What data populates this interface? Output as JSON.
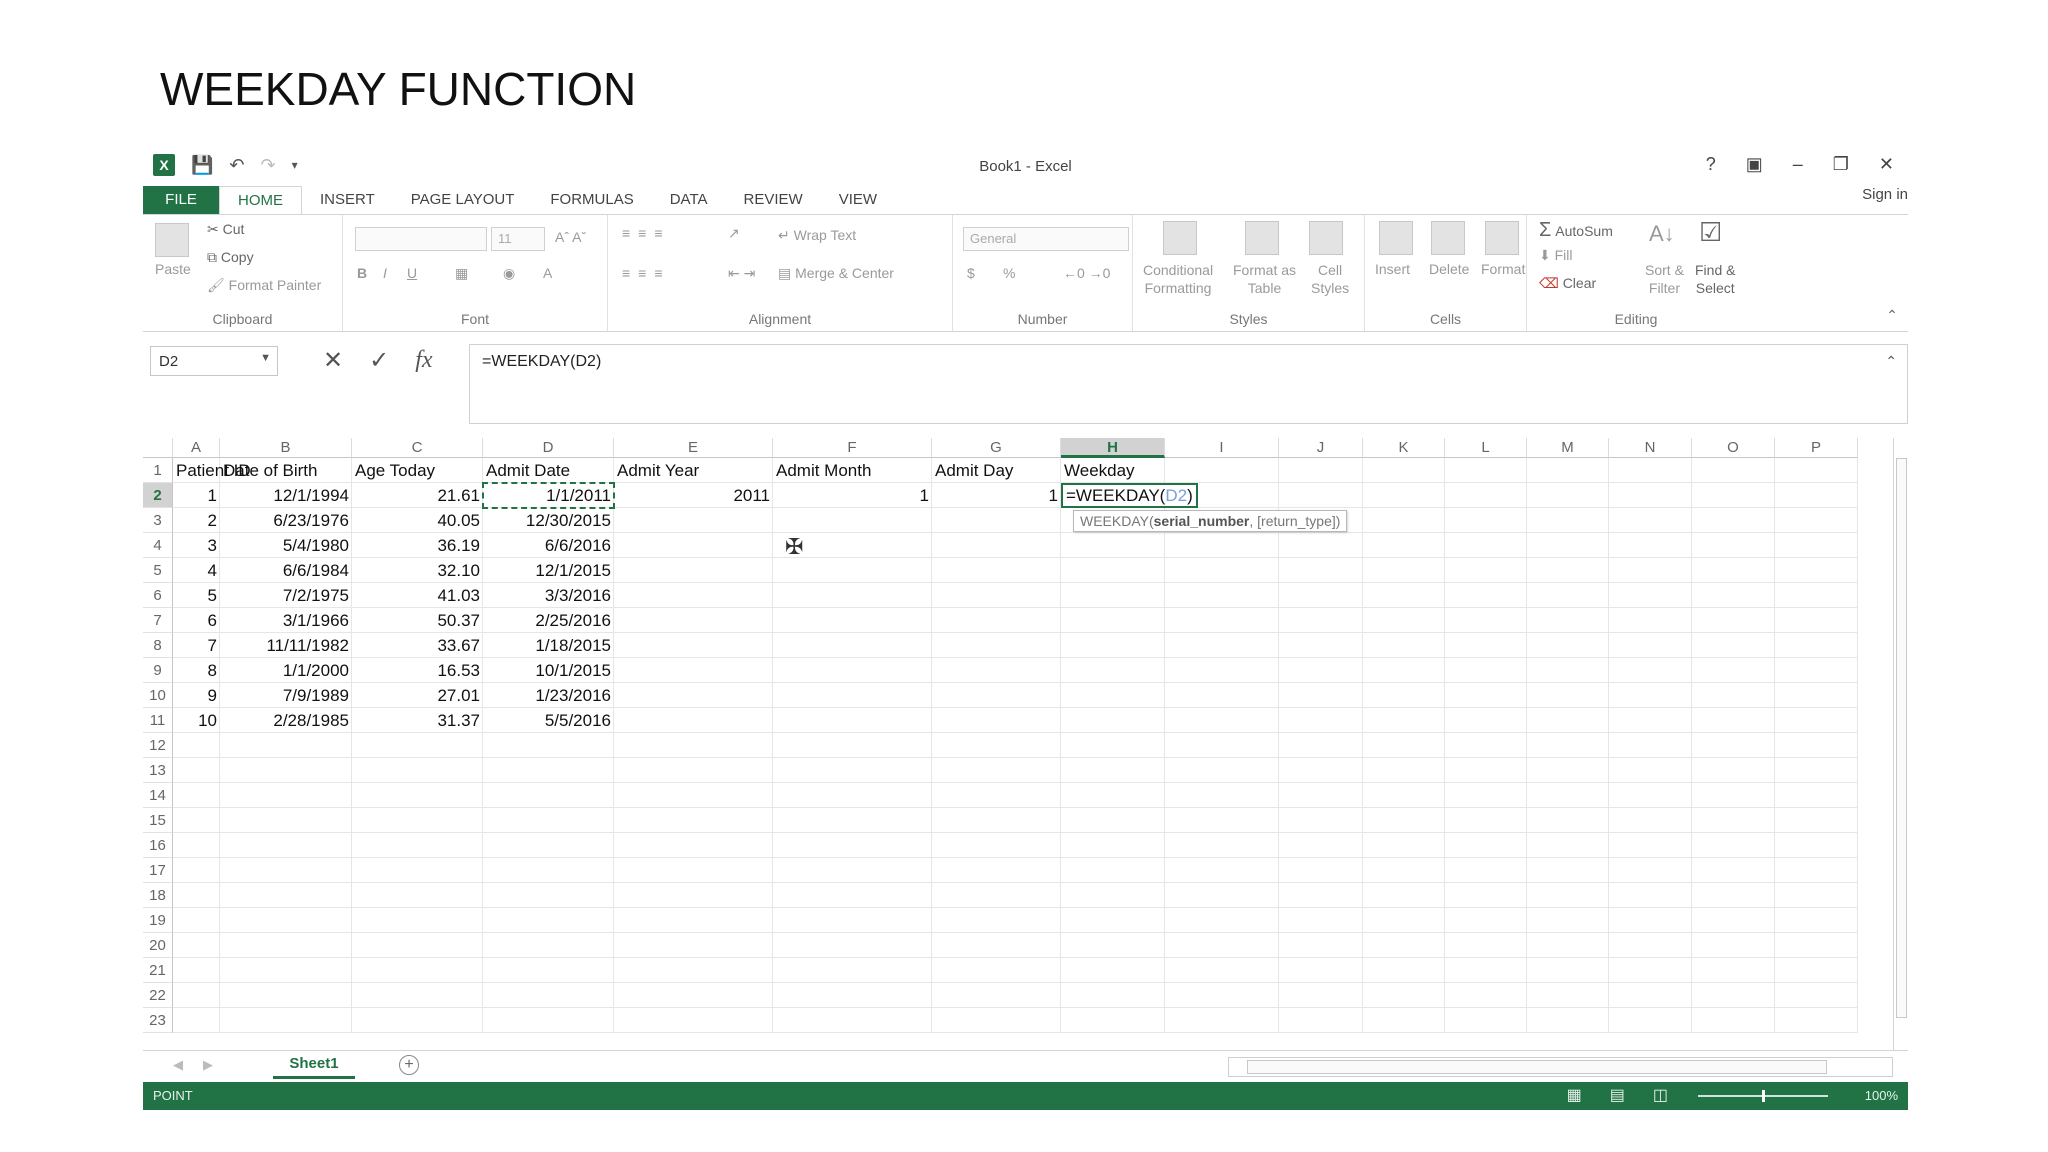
{
  "slide": {
    "title": "WEEKDAY FUNCTION"
  },
  "window": {
    "title": "Book1 - Excel",
    "help": "?",
    "minimize": "–",
    "restore": "❐",
    "close": "✕",
    "signin": "Sign in"
  },
  "tabs": [
    "FILE",
    "HOME",
    "INSERT",
    "PAGE LAYOUT",
    "FORMULAS",
    "DATA",
    "REVIEW",
    "VIEW"
  ],
  "ribbon": {
    "clipboard": {
      "label": "Clipboard",
      "paste": "Paste",
      "cut": "Cut",
      "copy": "Copy",
      "format_painter": "Format Painter"
    },
    "font": {
      "label": "Font",
      "size": "11",
      "bold": "B",
      "italic": "I",
      "underline": "U"
    },
    "alignment": {
      "label": "Alignment",
      "wrap": "Wrap Text",
      "merge": "Merge & Center"
    },
    "number": {
      "label": "Number",
      "format": "General",
      "currency": "$",
      "percent": "%"
    },
    "styles": {
      "label": "Styles",
      "conditional": "Conditional",
      "conditional2": "Formatting",
      "format_as": "Format as",
      "format_as2": "Table",
      "cell": "Cell",
      "cell2": "Styles"
    },
    "cells": {
      "label": "Cells",
      "insert": "Insert",
      "delete": "Delete",
      "format": "Format"
    },
    "editing": {
      "label": "Editing",
      "autosum": "AutoSum",
      "fill": "Fill",
      "clear": "Clear",
      "sort": "Sort &",
      "sort2": "Filter",
      "find": "Find &",
      "find2": "Select"
    }
  },
  "formula_bar": {
    "name_box": "D2",
    "formula": "=WEEKDAY(D2)",
    "cancel": "✕",
    "enter": "✓",
    "fx": "fx"
  },
  "columns": [
    "A",
    "B",
    "C",
    "D",
    "E",
    "F",
    "G",
    "H",
    "I",
    "J",
    "K",
    "L",
    "M",
    "N",
    "O",
    "P"
  ],
  "selected_column": "H",
  "selected_row": 2,
  "rows": [
    "1",
    "2",
    "3",
    "4",
    "5",
    "6",
    "7",
    "8",
    "9",
    "10",
    "11",
    "12",
    "13",
    "14",
    "15",
    "16",
    "17",
    "18",
    "19",
    "20",
    "21",
    "22",
    "23"
  ],
  "headers": [
    "Patient ID",
    "Date of Birth",
    "Age Today",
    "Admit Date",
    "Admit Year",
    "Admit Month",
    "Admit Day",
    "Weekday"
  ],
  "data": [
    {
      "id": "1",
      "dob": "12/1/1994",
      "age": "21.61",
      "admit": "1/1/2011",
      "year": "2011",
      "month": "1",
      "day": "1"
    },
    {
      "id": "2",
      "dob": "6/23/1976",
      "age": "40.05",
      "admit": "12/30/2015"
    },
    {
      "id": "3",
      "dob": "5/4/1980",
      "age": "36.19",
      "admit": "6/6/2016"
    },
    {
      "id": "4",
      "dob": "6/6/1984",
      "age": "32.10",
      "admit": "12/1/2015"
    },
    {
      "id": "5",
      "dob": "7/2/1975",
      "age": "41.03",
      "admit": "3/3/2016"
    },
    {
      "id": "6",
      "dob": "3/1/1966",
      "age": "50.37",
      "admit": "2/25/2016"
    },
    {
      "id": "7",
      "dob": "11/11/1982",
      "age": "33.67",
      "admit": "1/18/2015"
    },
    {
      "id": "8",
      "dob": "1/1/2000",
      "age": "16.53",
      "admit": "10/1/2015"
    },
    {
      "id": "9",
      "dob": "7/9/1989",
      "age": "27.01",
      "admit": "1/23/2016"
    },
    {
      "id": "10",
      "dob": "2/28/1985",
      "age": "31.37",
      "admit": "5/5/2016"
    }
  ],
  "editing_cell": {
    "prefix": "=WEEKDAY(",
    "ref": "D2",
    "suffix": ")"
  },
  "tooltip": {
    "fn": "WEEKDAY(",
    "arg1": "serial_number",
    "rest": ", [return_type])"
  },
  "sheet": {
    "name": "Sheet1",
    "add": "+"
  },
  "status": {
    "mode": "POINT",
    "zoom": "100%"
  },
  "colors": {
    "accent": "#217346"
  }
}
